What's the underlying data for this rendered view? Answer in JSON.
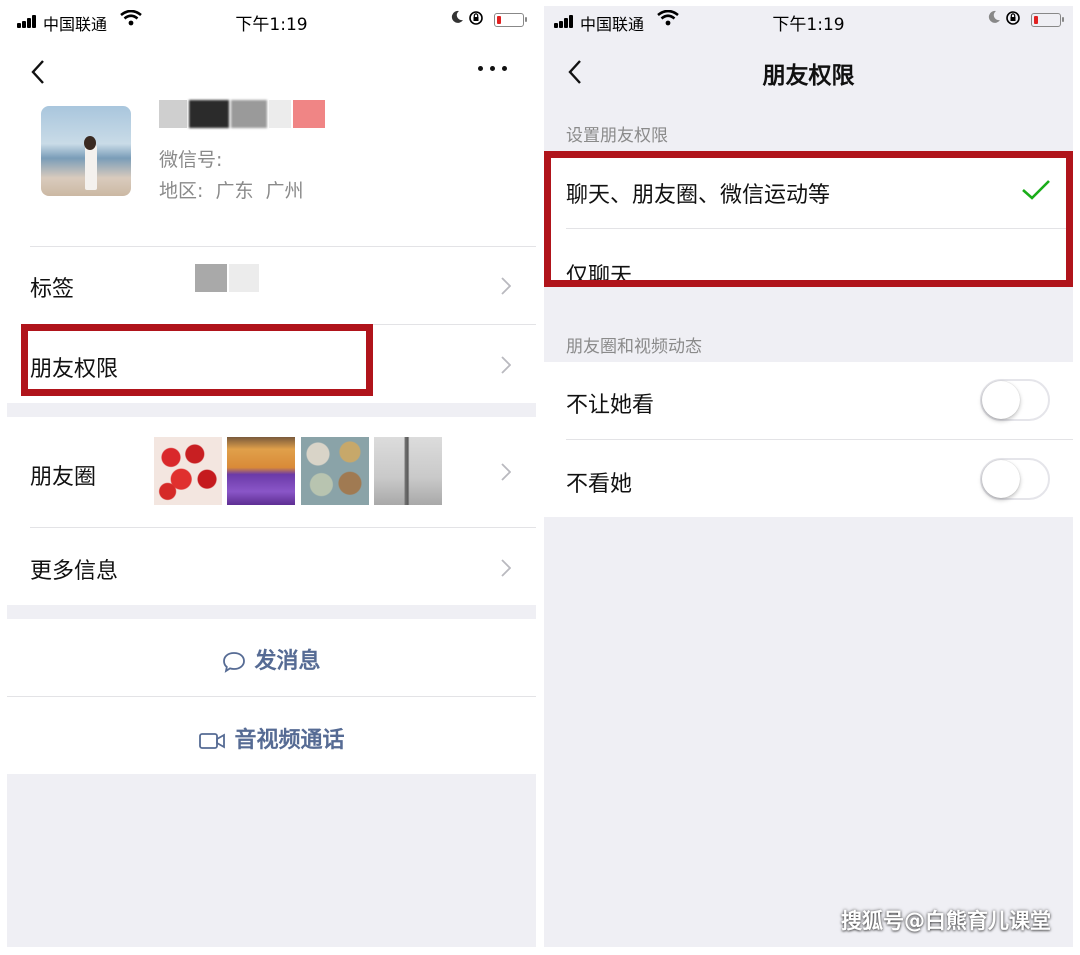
{
  "status_bar": {
    "carrier": "中国联通",
    "time": "下午1:19"
  },
  "profile_screen": {
    "wechat_id_label": "微信号:",
    "region_label": "地区:",
    "region_value": "广东 广州",
    "rows": {
      "tags": "标签",
      "friend_permissions": "朋友权限",
      "moments": "朋友圈",
      "more_info": "更多信息"
    },
    "actions": {
      "send_message": "发消息",
      "video_call": "音视频通话"
    }
  },
  "permissions_screen": {
    "title": "朋友权限",
    "section_permissions": "设置朋友权限",
    "option_all": "聊天、朋友圈、微信运动等",
    "option_chat_only": "仅聊天",
    "section_moments": "朋友圈和视频动态",
    "hide_my_posts": "不让她看",
    "hide_her_posts": "不看她",
    "hide_my_posts_on": false,
    "hide_her_posts_on": false
  },
  "watermark": "搜狐号@白熊育儿课堂",
  "colors": {
    "highlight_box": "#b0141b",
    "check": "#1aad19",
    "link": "#566b94"
  }
}
